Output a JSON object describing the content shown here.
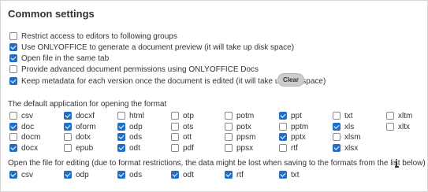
{
  "title": "Common settings",
  "options": [
    {
      "label": "Restrict access to editors to following groups",
      "checked": false
    },
    {
      "label": "Use ONLYOFFICE to generate a document preview (it will take up disk space)",
      "checked": true
    },
    {
      "label": "Open file in the same tab",
      "checked": true
    },
    {
      "label": "Provide advanced document permissions using ONLYOFFICE Docs",
      "checked": false
    },
    {
      "label": "Keep metadata for each version once the document is edited (it will take up disk space)",
      "checked": true
    }
  ],
  "clear_label": "Clear",
  "default_app": {
    "label": "The default application for opening the format",
    "rows": [
      [
        {
          "f": "csv",
          "c": false
        },
        {
          "f": "docxf",
          "c": true
        },
        {
          "f": "html",
          "c": false
        },
        {
          "f": "otp",
          "c": false
        },
        {
          "f": "potm",
          "c": false
        },
        {
          "f": "ppt",
          "c": true
        },
        {
          "f": "txt",
          "c": false
        },
        {
          "f": "xltm",
          "c": false
        }
      ],
      [
        {
          "f": "doc",
          "c": true
        },
        {
          "f": "oform",
          "c": true
        },
        {
          "f": "odp",
          "c": true
        },
        {
          "f": "ots",
          "c": false
        },
        {
          "f": "potx",
          "c": false
        },
        {
          "f": "pptm",
          "c": false
        },
        {
          "f": "xls",
          "c": true
        },
        {
          "f": "xltx",
          "c": false
        }
      ],
      [
        {
          "f": "docm",
          "c": false
        },
        {
          "f": "dotx",
          "c": false
        },
        {
          "f": "ods",
          "c": true
        },
        {
          "f": "ott",
          "c": false
        },
        {
          "f": "ppsm",
          "c": false
        },
        {
          "f": "pptx",
          "c": true
        },
        {
          "f": "xlsm",
          "c": false
        }
      ],
      [
        {
          "f": "docx",
          "c": true
        },
        {
          "f": "epub",
          "c": false
        },
        {
          "f": "odt",
          "c": true
        },
        {
          "f": "pdf",
          "c": false
        },
        {
          "f": "ppsx",
          "c": false
        },
        {
          "f": "rtf",
          "c": false
        },
        {
          "f": "xlsx",
          "c": true
        }
      ]
    ]
  },
  "edit": {
    "label": "Open the file for editing (due to format restrictions, the data might be lost when saving to the formats from the list below)",
    "info_icon": "info-icon",
    "items": [
      {
        "f": "csv",
        "c": true
      },
      {
        "f": "odp",
        "c": true
      },
      {
        "f": "ods",
        "c": true
      },
      {
        "f": "odt",
        "c": true
      },
      {
        "f": "rtf",
        "c": true
      },
      {
        "f": "txt",
        "c": true
      }
    ]
  },
  "colors": {
    "accent": "#1f6fc9",
    "button_bg": "#cccccc"
  }
}
